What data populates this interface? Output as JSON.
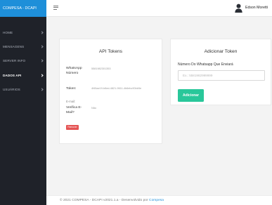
{
  "brand": {
    "title": "COMPESA - DCAPI"
  },
  "topbar": {
    "menu_icon": "hamburger-icon",
    "user_icon": "user-avatar-icon",
    "user_name": "Edson Moretti"
  },
  "sidebar": {
    "items": [
      {
        "label": "HOME"
      },
      {
        "label": "MENSAGENS"
      },
      {
        "label": "SERVER INFO"
      },
      {
        "label": "DADOS API"
      },
      {
        "label": "USUÁRIOS"
      }
    ],
    "active_index": 3
  },
  "tokens_card": {
    "title": "API Tokens",
    "whatsapp_label": "WhatsApp Número",
    "whatsapp_value": "5581982301353",
    "token_label": "Token:",
    "token_value": "4f45ae19-b8ed-4821-9611-4b6ebc90bb5e",
    "email_label": "E-mail:",
    "verifica_label": "Verifica E-Mail?",
    "verifica_value": "Não",
    "remove_label": "Remover"
  },
  "add_card": {
    "title": "Adicionar Token",
    "field_label": "Número Do Whatsapp Que Enviará",
    "placeholder": "Ex.: 5581982999999",
    "value": "",
    "add_label": "Adicionar"
  },
  "footer": {
    "text": "© 2021 COMPESA - DCAPI v2021.1.a - Desenvolvido por",
    "link": "Compesa"
  },
  "colors": {
    "brand": "#1e8fd9",
    "sidebar": "#1f2229",
    "add_button": "#29c79a",
    "remove_button": "#e55353"
  }
}
